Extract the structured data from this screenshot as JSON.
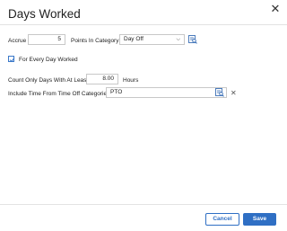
{
  "dialog": {
    "title": "Days Worked",
    "close_glyph": "✕"
  },
  "accrue": {
    "label": "Accrue",
    "value": "5",
    "points_label": "Points In Category",
    "category_value": "Day Off"
  },
  "every_day": {
    "checked": true,
    "label": "For Every Day Worked"
  },
  "count_only": {
    "label": "Count Only Days With At Least",
    "value": "8.00",
    "unit": "Hours"
  },
  "include_time": {
    "label": "Include Time From Time Off Categories",
    "value": "PTO",
    "clear_glyph": "✕"
  },
  "footer": {
    "cancel_label": "Cancel",
    "save_label": "Save"
  },
  "colors": {
    "accent": "#2f6fc4"
  }
}
